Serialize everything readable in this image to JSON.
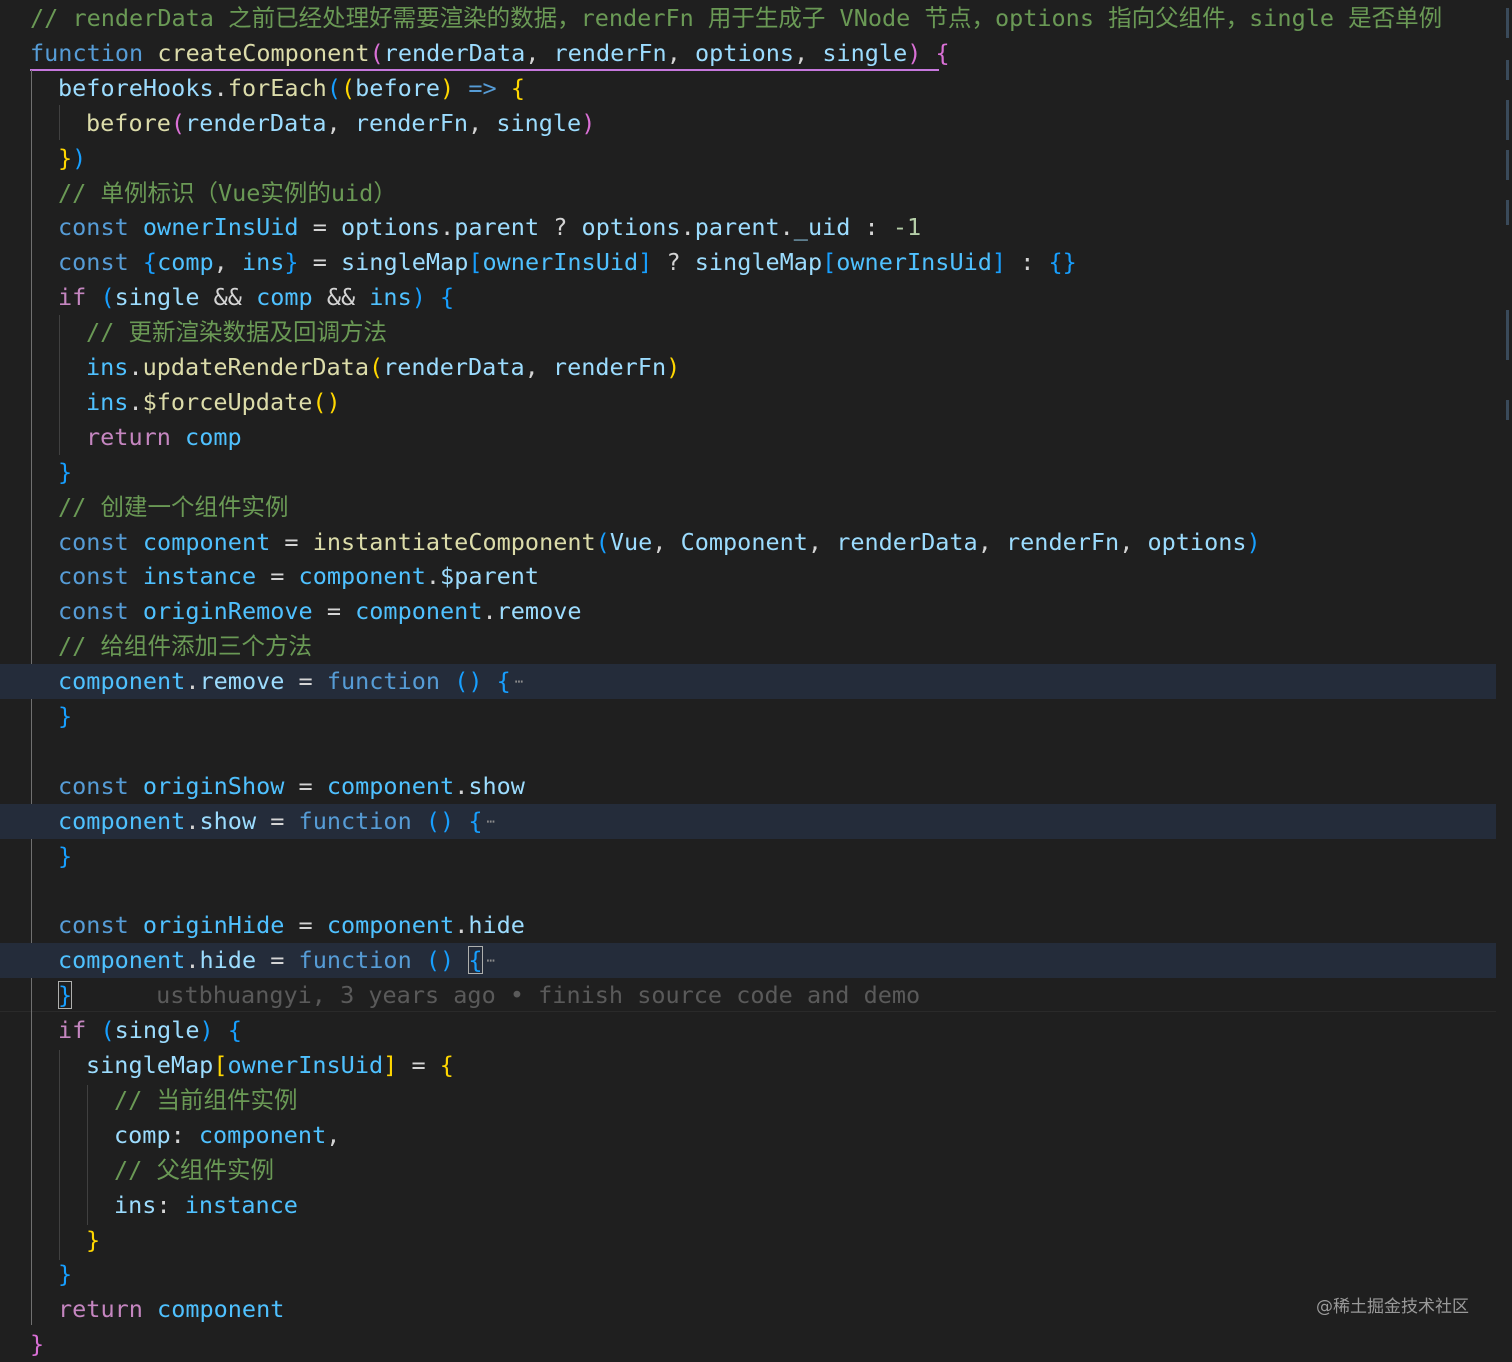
{
  "editor": {
    "lines": [
      {
        "indent": 0,
        "tokens": [
          {
            "t": "// renderData 之前已经处理好需要渲染的数据，renderFn 用于生成子 VNode 节点，options 指向父组件，single 是否单例",
            "c": "comment"
          }
        ]
      },
      {
        "indent": 0,
        "tokens": [
          {
            "t": "function",
            "c": "kw"
          },
          {
            "t": " "
          },
          {
            "t": "createComponent",
            "c": "fn"
          },
          {
            "t": "(",
            "c": "b2"
          },
          {
            "t": "renderData",
            "c": "var"
          },
          {
            "t": ", "
          },
          {
            "t": "renderFn",
            "c": "var"
          },
          {
            "t": ", "
          },
          {
            "t": "options",
            "c": "var"
          },
          {
            "t": ", "
          },
          {
            "t": "single",
            "c": "var"
          },
          {
            "t": ")",
            "c": "b2"
          },
          {
            "t": " "
          },
          {
            "t": "{",
            "c": "b2"
          }
        ]
      },
      {
        "indent": 1,
        "tokens": [
          {
            "t": "beforeHooks",
            "c": "var"
          },
          {
            "t": "."
          },
          {
            "t": "forEach",
            "c": "fn"
          },
          {
            "t": "(",
            "c": "b3"
          },
          {
            "t": "(",
            "c": "b1"
          },
          {
            "t": "before",
            "c": "var"
          },
          {
            "t": ")",
            "c": "b1"
          },
          {
            "t": " "
          },
          {
            "t": "=>",
            "c": "kw"
          },
          {
            "t": " "
          },
          {
            "t": "{",
            "c": "b1"
          }
        ]
      },
      {
        "indent": 2,
        "tokens": [
          {
            "t": "before",
            "c": "fn"
          },
          {
            "t": "(",
            "c": "b2"
          },
          {
            "t": "renderData",
            "c": "var"
          },
          {
            "t": ", "
          },
          {
            "t": "renderFn",
            "c": "var"
          },
          {
            "t": ", "
          },
          {
            "t": "single",
            "c": "var"
          },
          {
            "t": ")",
            "c": "b2"
          }
        ]
      },
      {
        "indent": 1,
        "tokens": [
          {
            "t": "}",
            "c": "b1"
          },
          {
            "t": ")",
            "c": "b3"
          }
        ]
      },
      {
        "indent": 1,
        "tokens": [
          {
            "t": "// 单例标识（Vue实例的uid）",
            "c": "comment"
          }
        ]
      },
      {
        "indent": 1,
        "tokens": [
          {
            "t": "const",
            "c": "kw"
          },
          {
            "t": " "
          },
          {
            "t": "ownerInsUid",
            "c": "const"
          },
          {
            "t": " = "
          },
          {
            "t": "options",
            "c": "var"
          },
          {
            "t": "."
          },
          {
            "t": "parent",
            "c": "var"
          },
          {
            "t": " ? "
          },
          {
            "t": "options",
            "c": "var"
          },
          {
            "t": "."
          },
          {
            "t": "parent",
            "c": "var"
          },
          {
            "t": "."
          },
          {
            "t": "_uid",
            "c": "var"
          },
          {
            "t": " : "
          },
          {
            "t": "-1",
            "c": "num"
          }
        ]
      },
      {
        "indent": 1,
        "tokens": [
          {
            "t": "const",
            "c": "kw"
          },
          {
            "t": " "
          },
          {
            "t": "{",
            "c": "b3"
          },
          {
            "t": "comp",
            "c": "const"
          },
          {
            "t": ", "
          },
          {
            "t": "ins",
            "c": "const"
          },
          {
            "t": "}",
            "c": "b3"
          },
          {
            "t": " = "
          },
          {
            "t": "singleMap",
            "c": "var"
          },
          {
            "t": "[",
            "c": "b3"
          },
          {
            "t": "ownerInsUid",
            "c": "const"
          },
          {
            "t": "]",
            "c": "b3"
          },
          {
            "t": " ? "
          },
          {
            "t": "singleMap",
            "c": "var"
          },
          {
            "t": "[",
            "c": "b3"
          },
          {
            "t": "ownerInsUid",
            "c": "const"
          },
          {
            "t": "]",
            "c": "b3"
          },
          {
            "t": " : "
          },
          {
            "t": "{}",
            "c": "b3"
          }
        ]
      },
      {
        "indent": 1,
        "tokens": [
          {
            "t": "if",
            "c": "ctrl"
          },
          {
            "t": " "
          },
          {
            "t": "(",
            "c": "b3"
          },
          {
            "t": "single",
            "c": "var"
          },
          {
            "t": " && "
          },
          {
            "t": "comp",
            "c": "const"
          },
          {
            "t": " && "
          },
          {
            "t": "ins",
            "c": "const"
          },
          {
            "t": ")",
            "c": "b3"
          },
          {
            "t": " "
          },
          {
            "t": "{",
            "c": "b3"
          }
        ]
      },
      {
        "indent": 2,
        "tokens": [
          {
            "t": "// 更新渲染数据及回调方法",
            "c": "comment"
          }
        ]
      },
      {
        "indent": 2,
        "tokens": [
          {
            "t": "ins",
            "c": "const"
          },
          {
            "t": "."
          },
          {
            "t": "updateRenderData",
            "c": "fn"
          },
          {
            "t": "(",
            "c": "b1"
          },
          {
            "t": "renderData",
            "c": "var"
          },
          {
            "t": ", "
          },
          {
            "t": "renderFn",
            "c": "var"
          },
          {
            "t": ")",
            "c": "b1"
          }
        ]
      },
      {
        "indent": 2,
        "tokens": [
          {
            "t": "ins",
            "c": "const"
          },
          {
            "t": "."
          },
          {
            "t": "$forceUpdate",
            "c": "fn"
          },
          {
            "t": "()",
            "c": "b1"
          }
        ]
      },
      {
        "indent": 2,
        "tokens": [
          {
            "t": "return",
            "c": "ctrl"
          },
          {
            "t": " "
          },
          {
            "t": "comp",
            "c": "const"
          }
        ]
      },
      {
        "indent": 1,
        "tokens": [
          {
            "t": "}",
            "c": "b3"
          }
        ]
      },
      {
        "indent": 1,
        "tokens": [
          {
            "t": "// 创建一个组件实例",
            "c": "comment"
          }
        ]
      },
      {
        "indent": 1,
        "tokens": [
          {
            "t": "const",
            "c": "kw"
          },
          {
            "t": " "
          },
          {
            "t": "component",
            "c": "const"
          },
          {
            "t": " = "
          },
          {
            "t": "instantiateComponent",
            "c": "fn"
          },
          {
            "t": "(",
            "c": "b3"
          },
          {
            "t": "Vue",
            "c": "var"
          },
          {
            "t": ", "
          },
          {
            "t": "Component",
            "c": "var"
          },
          {
            "t": ", "
          },
          {
            "t": "renderData",
            "c": "var"
          },
          {
            "t": ", "
          },
          {
            "t": "renderFn",
            "c": "var"
          },
          {
            "t": ", "
          },
          {
            "t": "options",
            "c": "var"
          },
          {
            "t": ")",
            "c": "b3"
          }
        ]
      },
      {
        "indent": 1,
        "tokens": [
          {
            "t": "const",
            "c": "kw"
          },
          {
            "t": " "
          },
          {
            "t": "instance",
            "c": "const"
          },
          {
            "t": " = "
          },
          {
            "t": "component",
            "c": "const"
          },
          {
            "t": "."
          },
          {
            "t": "$parent",
            "c": "var"
          }
        ]
      },
      {
        "indent": 1,
        "tokens": [
          {
            "t": "const",
            "c": "kw"
          },
          {
            "t": " "
          },
          {
            "t": "originRemove",
            "c": "const"
          },
          {
            "t": " = "
          },
          {
            "t": "component",
            "c": "const"
          },
          {
            "t": "."
          },
          {
            "t": "remove",
            "c": "var"
          }
        ]
      },
      {
        "indent": 1,
        "tokens": [
          {
            "t": "// 给组件添加三个方法",
            "c": "comment"
          }
        ]
      },
      {
        "indent": 1,
        "folded": true,
        "tokens": [
          {
            "t": "component",
            "c": "const"
          },
          {
            "t": "."
          },
          {
            "t": "remove",
            "c": "var"
          },
          {
            "t": " = "
          },
          {
            "t": "function",
            "c": "kw"
          },
          {
            "t": " "
          },
          {
            "t": "()",
            "c": "b3"
          },
          {
            "t": " "
          },
          {
            "t": "{",
            "c": "b3"
          },
          {
            "t": "⋯",
            "c": "fold"
          }
        ]
      },
      {
        "indent": 1,
        "tokens": [
          {
            "t": "}",
            "c": "b3"
          }
        ]
      },
      {
        "indent": 0,
        "tokens": []
      },
      {
        "indent": 1,
        "tokens": [
          {
            "t": "const",
            "c": "kw"
          },
          {
            "t": " "
          },
          {
            "t": "originShow",
            "c": "const"
          },
          {
            "t": " = "
          },
          {
            "t": "component",
            "c": "const"
          },
          {
            "t": "."
          },
          {
            "t": "show",
            "c": "var"
          }
        ]
      },
      {
        "indent": 1,
        "folded": true,
        "tokens": [
          {
            "t": "component",
            "c": "const"
          },
          {
            "t": "."
          },
          {
            "t": "show",
            "c": "var"
          },
          {
            "t": " = "
          },
          {
            "t": "function",
            "c": "kw"
          },
          {
            "t": " "
          },
          {
            "t": "()",
            "c": "b3"
          },
          {
            "t": " "
          },
          {
            "t": "{",
            "c": "b3"
          },
          {
            "t": "⋯",
            "c": "fold"
          }
        ]
      },
      {
        "indent": 1,
        "tokens": [
          {
            "t": "}",
            "c": "b3"
          }
        ]
      },
      {
        "indent": 0,
        "tokens": []
      },
      {
        "indent": 1,
        "tokens": [
          {
            "t": "const",
            "c": "kw"
          },
          {
            "t": " "
          },
          {
            "t": "originHide",
            "c": "const"
          },
          {
            "t": " = "
          },
          {
            "t": "component",
            "c": "const"
          },
          {
            "t": "."
          },
          {
            "t": "hide",
            "c": "var"
          }
        ]
      },
      {
        "indent": 1,
        "folded": true,
        "tokens": [
          {
            "t": "component",
            "c": "const"
          },
          {
            "t": "."
          },
          {
            "t": "hide",
            "c": "var"
          },
          {
            "t": " = "
          },
          {
            "t": "function",
            "c": "kw"
          },
          {
            "t": " "
          },
          {
            "t": "()",
            "c": "b3"
          },
          {
            "t": " "
          },
          {
            "t": "{",
            "c": "b3",
            "box": true
          },
          {
            "t": "⋯",
            "c": "fold"
          }
        ]
      },
      {
        "indent": 1,
        "tokens": [
          {
            "t": "}",
            "c": "b3",
            "box": true
          }
        ],
        "blame": "ustbhuangyi, 3 years ago • finish source code and demo"
      },
      {
        "indent": 1,
        "tokens": [
          {
            "t": "if",
            "c": "ctrl"
          },
          {
            "t": " "
          },
          {
            "t": "(",
            "c": "b3"
          },
          {
            "t": "single",
            "c": "var"
          },
          {
            "t": ")",
            "c": "b3"
          },
          {
            "t": " "
          },
          {
            "t": "{",
            "c": "b3"
          }
        ]
      },
      {
        "indent": 2,
        "tokens": [
          {
            "t": "singleMap",
            "c": "var"
          },
          {
            "t": "[",
            "c": "b1"
          },
          {
            "t": "ownerInsUid",
            "c": "const"
          },
          {
            "t": "]",
            "c": "b1"
          },
          {
            "t": " = "
          },
          {
            "t": "{",
            "c": "b1"
          }
        ]
      },
      {
        "indent": 3,
        "tokens": [
          {
            "t": "// 当前组件实例",
            "c": "comment"
          }
        ]
      },
      {
        "indent": 3,
        "tokens": [
          {
            "t": "comp",
            "c": "var"
          },
          {
            "t": ": "
          },
          {
            "t": "component",
            "c": "const"
          },
          {
            "t": ","
          }
        ]
      },
      {
        "indent": 3,
        "tokens": [
          {
            "t": "// 父组件实例",
            "c": "comment"
          }
        ]
      },
      {
        "indent": 3,
        "tokens": [
          {
            "t": "ins",
            "c": "var"
          },
          {
            "t": ": "
          },
          {
            "t": "instance",
            "c": "const"
          }
        ]
      },
      {
        "indent": 2,
        "tokens": [
          {
            "t": "}",
            "c": "b1"
          }
        ]
      },
      {
        "indent": 1,
        "tokens": [
          {
            "t": "}",
            "c": "b3"
          }
        ]
      },
      {
        "indent": 1,
        "tokens": [
          {
            "t": "return",
            "c": "ctrl"
          },
          {
            "t": " "
          },
          {
            "t": "component",
            "c": "const"
          }
        ]
      },
      {
        "indent": 0,
        "tokens": [
          {
            "t": "}",
            "c": "b2"
          }
        ]
      }
    ]
  },
  "watermark": "@稀土掘金技术社区",
  "colors": {
    "background": "#1f1f1f",
    "folded_line_highlight": "#242c3a",
    "comment": "#6a9955",
    "keyword": "#569cd6",
    "control": "#c586c0",
    "function": "#dcdcaa",
    "variable": "#9cdcfe",
    "constant": "#4fc1ff",
    "bracket_gold": "#ffd700",
    "bracket_orchid": "#da70d6",
    "bracket_blue": "#179fff"
  }
}
